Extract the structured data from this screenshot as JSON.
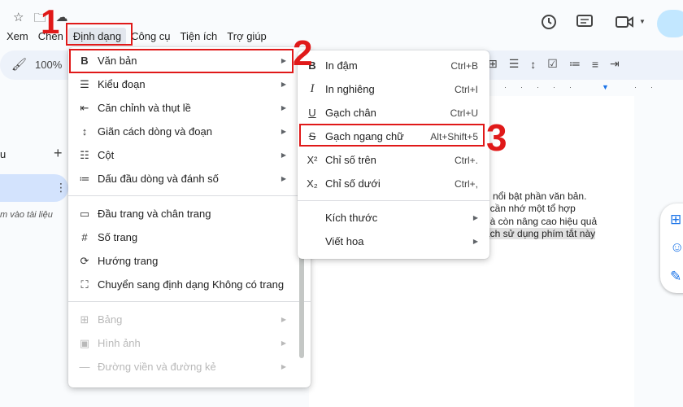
{
  "menubar": {
    "items": [
      "Xem",
      "Chèn",
      "Định dạng",
      "Công cụ",
      "Tiện ích",
      "Trợ giúp"
    ]
  },
  "toolbar": {
    "zoom": "100%"
  },
  "left_panel": {
    "heading_fragment": "u",
    "hint_fragment": "m vào tài liệu"
  },
  "format_menu": {
    "items": [
      {
        "icon": "bold-icon",
        "label": "Văn bản",
        "submenu": true
      },
      {
        "icon": "paragraph-style-icon",
        "label": "Kiểu đoạn",
        "submenu": true
      },
      {
        "icon": "align-indent-icon",
        "label": "Căn chỉnh và thụt lề",
        "submenu": true
      },
      {
        "icon": "line-spacing-icon",
        "label": "Giãn cách dòng và đoạn",
        "submenu": true
      },
      {
        "icon": "columns-icon",
        "label": "Cột",
        "submenu": true
      },
      {
        "icon": "bulleted-list-icon",
        "label": "Dấu đầu dòng và đánh số",
        "submenu": true
      },
      {
        "icon": "header-footer-icon",
        "label": "Đầu trang và chân trang",
        "submenu": false
      },
      {
        "icon": "page-number-icon",
        "label": "Số trang",
        "submenu": false
      },
      {
        "icon": "orientation-icon",
        "label": "Hướng trang",
        "submenu": false
      },
      {
        "icon": "pageless-icon",
        "label": "Chuyển sang định dạng Không có trang",
        "submenu": false
      },
      {
        "icon": "table-icon",
        "label": "Bảng",
        "submenu": true,
        "disabled": true
      },
      {
        "icon": "image-icon",
        "label": "Hình ảnh",
        "submenu": true,
        "disabled": true
      },
      {
        "icon": "borders-icon",
        "label": "Đường viền và đường kẻ",
        "submenu": true,
        "disabled": true
      }
    ]
  },
  "text_submenu": {
    "items": [
      {
        "icon": "B",
        "label": "In đậm",
        "shortcut": "Ctrl+B"
      },
      {
        "icon": "I",
        "label": "In nghiêng",
        "shortcut": "Ctrl+I"
      },
      {
        "icon": "U",
        "label": "Gạch chân",
        "shortcut": "Ctrl+U"
      },
      {
        "icon": "S",
        "label": "Gạch ngang chữ",
        "shortcut": "Alt+Shift+5"
      },
      {
        "icon": "X²",
        "label": "Chỉ số trên",
        "shortcut": "Ctrl+."
      },
      {
        "icon": "X₂",
        "label": "Chỉ số dưới",
        "shortcut": "Ctrl+,"
      },
      {
        "label": "Kích thước",
        "submenu": true
      },
      {
        "label": "Viết hoa",
        "submenu": true
      }
    ]
  },
  "document": {
    "lines": [
      "n nổi bật phần văn bản.",
      "ĩ cần nhớ một tổ hợp",
      "nà còn nâng cao hiệu quả",
      "ách sử dụng phím tắt này"
    ]
  },
  "steps": [
    "1",
    "2",
    "3"
  ],
  "colors": {
    "highlight": "#e01919",
    "selected_tab": "#d3e3fd",
    "toolbar": "#edf2fa"
  }
}
